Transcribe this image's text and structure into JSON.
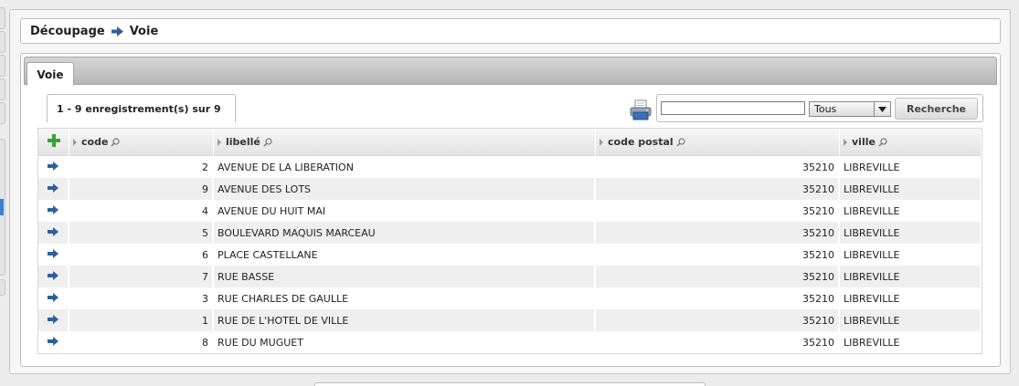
{
  "breadcrumb": {
    "part1": "Découpage",
    "part2": "Voie"
  },
  "tab": {
    "label": "Voie"
  },
  "pagination": {
    "text": "1 - 9 enregistrement(s) sur 9"
  },
  "search": {
    "value": "",
    "filter_selected": "Tous",
    "button_label": "Recherche"
  },
  "table": {
    "columns": [
      {
        "label": "code"
      },
      {
        "label": "libellé"
      },
      {
        "label": "code postal"
      },
      {
        "label": "ville"
      }
    ],
    "rows": [
      {
        "code": "2",
        "libelle": "AVENUE DE LA LIBERATION",
        "code_postal": "35210",
        "ville": "LIBREVILLE"
      },
      {
        "code": "9",
        "libelle": "AVENUE DES LOTS",
        "code_postal": "35210",
        "ville": "LIBREVILLE"
      },
      {
        "code": "4",
        "libelle": "AVENUE DU HUIT MAI",
        "code_postal": "35210",
        "ville": "LIBREVILLE"
      },
      {
        "code": "5",
        "libelle": "BOULEVARD MAQUIS MARCEAU",
        "code_postal": "35210",
        "ville": "LIBREVILLE"
      },
      {
        "code": "6",
        "libelle": "PLACE CASTELLANE",
        "code_postal": "35210",
        "ville": "LIBREVILLE"
      },
      {
        "code": "7",
        "libelle": "RUE BASSE",
        "code_postal": "35210",
        "ville": "LIBREVILLE"
      },
      {
        "code": "3",
        "libelle": "RUE CHARLES DE GAULLE",
        "code_postal": "35210",
        "ville": "LIBREVILLE"
      },
      {
        "code": "1",
        "libelle": "RUE DE L'HOTEL DE VILLE",
        "code_postal": "35210",
        "ville": "LIBREVILLE"
      },
      {
        "code": "8",
        "libelle": "RUE DU MUGUET",
        "code_postal": "35210",
        "ville": "LIBREVILLE"
      }
    ]
  },
  "icons": {
    "breadcrumb_separator": "arrow-right-icon",
    "add": "plus-icon",
    "row_action": "arrow-right-icon",
    "print": "printer-icon",
    "column_search": "magnifier-icon",
    "dropdown": "chevron-down-icon"
  },
  "colors": {
    "accent_blue": "#2e5f9e",
    "add_green": "#3aa335",
    "active_blue": "#3a7fd5"
  }
}
